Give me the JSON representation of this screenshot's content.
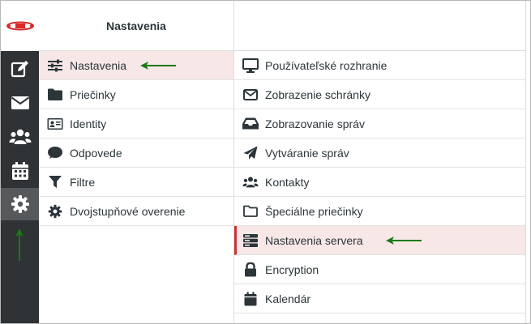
{
  "colors": {
    "rail": "#2f3335",
    "selected_row": "#f7e7e7",
    "selected_marker": "#c83333",
    "annotation_arrow": "#1a7a14",
    "logo": "#d82a2a"
  },
  "rail": {
    "logo_icon": "brand-logo",
    "items": [
      {
        "icon": "compose-icon",
        "active": false
      },
      {
        "icon": "mail-icon",
        "active": false
      },
      {
        "icon": "contacts-icon",
        "active": false
      },
      {
        "icon": "calendar-icon",
        "active": false
      },
      {
        "icon": "gear-icon",
        "active": true
      }
    ]
  },
  "settings_column": {
    "title": "Nastavenia",
    "items": [
      {
        "label": "Nastavenia",
        "icon": "sliders-icon",
        "selected": true
      },
      {
        "label": "Priečinky",
        "icon": "folder-icon",
        "selected": false
      },
      {
        "label": "Identity",
        "icon": "id-card-icon",
        "selected": false
      },
      {
        "label": "Odpovede",
        "icon": "comment-icon",
        "selected": false
      },
      {
        "label": "Filtre",
        "icon": "filter-icon",
        "selected": false
      },
      {
        "label": "Dvojstupňové overenie",
        "icon": "cog-icon",
        "selected": false
      }
    ]
  },
  "sections_column": {
    "items": [
      {
        "label": "Používateľské rozhranie",
        "icon": "monitor-icon",
        "selected": false
      },
      {
        "label": "Zobrazenie schránky",
        "icon": "envelope-icon",
        "selected": false
      },
      {
        "label": "Zobrazovanie správ",
        "icon": "inbox-icon",
        "selected": false
      },
      {
        "label": "Vytváranie správ",
        "icon": "paper-plane-icon",
        "selected": false
      },
      {
        "label": "Kontakty",
        "icon": "users-icon",
        "selected": false
      },
      {
        "label": "Špeciálne priečinky",
        "icon": "folder-outline-icon",
        "selected": false
      },
      {
        "label": "Nastavenia servera",
        "icon": "server-icon",
        "selected": true
      },
      {
        "label": "Encryption",
        "icon": "lock-icon",
        "selected": false
      },
      {
        "label": "Kalendár",
        "icon": "calendar-small-icon",
        "selected": false
      }
    ]
  }
}
